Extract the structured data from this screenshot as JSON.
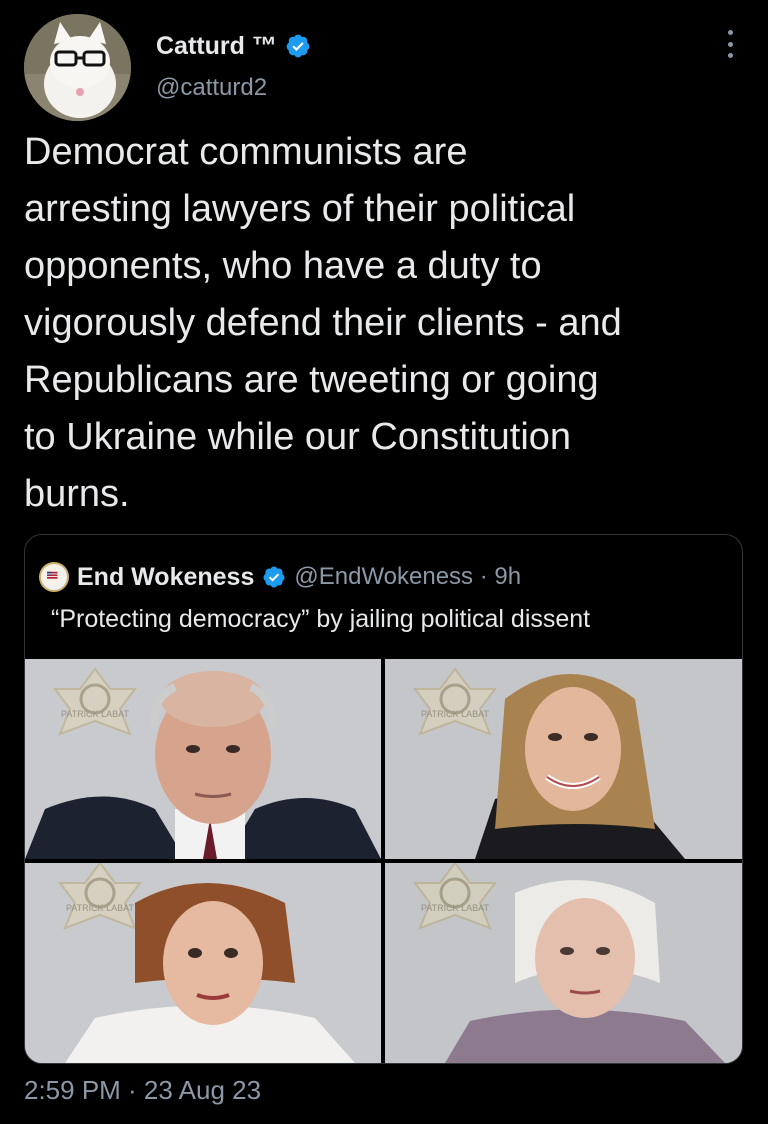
{
  "tweet": {
    "display_name": "Catturd ™",
    "handle": "@catturd2",
    "text": "Democrat communists are\narresting lawyers of their political\nopponents, who have a duty to\nvigorously defend their clients - and\nRepublicans are tweeting or going\nto Ukraine while our Constitution\nburns.",
    "timestamp": "2:59 PM · 23 Aug 23"
  },
  "quoted_tweet": {
    "display_name": "End Wokeness",
    "handle_time": "@EndWokeness · 9h",
    "text": "“Protecting democracy” by jailing political dissent",
    "photos": [
      {
        "badge_text": "PATRICK LABAT"
      },
      {
        "badge_text": "PATRICK LABAT"
      },
      {
        "badge_text": "PATRICK LABAT"
      },
      {
        "badge_text": "PATRICK LABAT"
      }
    ]
  },
  "colors": {
    "background": "#000000",
    "primary_text": "#e7e9ea",
    "secondary_text": "#8b98a5",
    "verified": "#1d9bf0",
    "border": "#333639"
  },
  "icons": [
    "avatar-cat-image",
    "verified-badge-icon",
    "more-options-icon"
  ]
}
